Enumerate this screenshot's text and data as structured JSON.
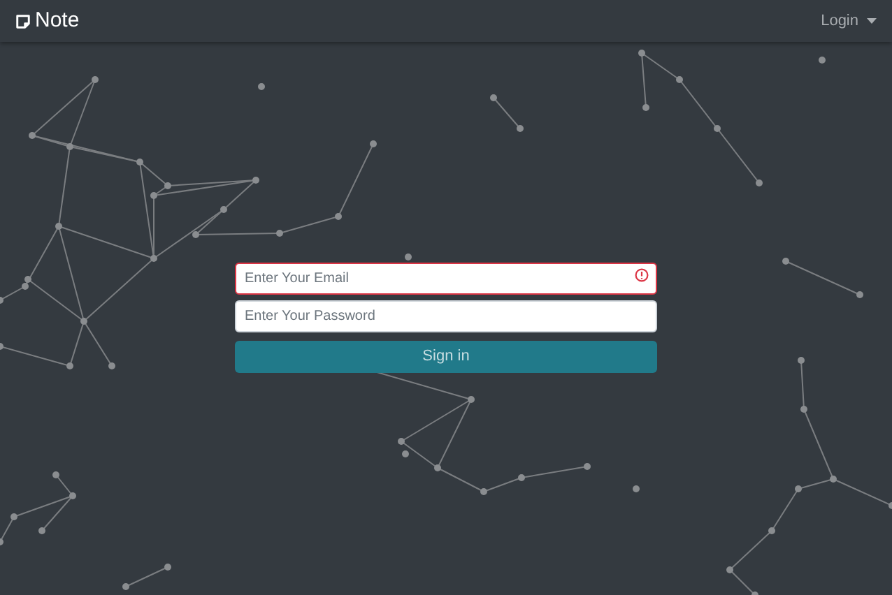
{
  "navbar": {
    "brand": "Note",
    "menu": "Login"
  },
  "form": {
    "email": {
      "placeholder": "Enter Your Email",
      "invalid": true
    },
    "password": {
      "placeholder": "Enter Your Password"
    },
    "submit": "Sign in"
  }
}
